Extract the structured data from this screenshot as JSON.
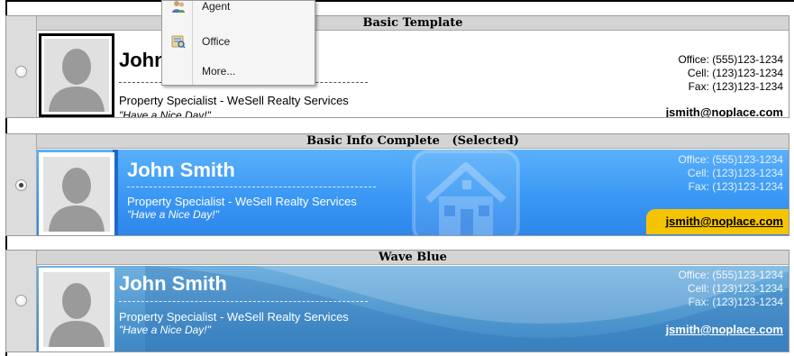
{
  "templates": [
    {
      "header": "Basic Template",
      "selected": false,
      "name": "John",
      "title": "Property Specialist - WeSell Realty Services",
      "motto": "\"Have a Nice Day!\"",
      "office": "Office: (555)123-1234",
      "cell": "Cell: (123)123-1234",
      "fax": "Fax: (123)123-1234",
      "email": "jsmith@noplace.com"
    },
    {
      "header": "Basic Info Complete   (Selected)",
      "selected": true,
      "name": "John Smith",
      "title": "Property Specialist - WeSell Realty Services",
      "motto": "\"Have a Nice Day!\"",
      "office": "Office: (555)123-1234",
      "cell": "Cell: (123)123-1234",
      "fax": "Fax: (123)123-1234",
      "email": "jsmith@noplace.com"
    },
    {
      "header": "Wave Blue",
      "selected": false,
      "name": "John Smith",
      "title": "Property Specialist - WeSell Realty Services",
      "motto": "\"Have a Nice Day!\"",
      "office": "Office: (555)123-1234",
      "cell": "Cell: (123)123-1234",
      "fax": "Fax: (123)123-1234",
      "email": "jsmith@noplace.com"
    }
  ],
  "context_menu": {
    "items": [
      {
        "label": "Agent",
        "icon": "agent-icon"
      },
      {
        "label": "Office",
        "icon": "office-icon"
      },
      {
        "label": "More...",
        "icon": ""
      }
    ]
  },
  "colors": {
    "blue_card": "#3a98f4",
    "wave_card": "#4f97cf",
    "email_highlight": "#f5c400",
    "header_bg": "#d4d4d4"
  }
}
